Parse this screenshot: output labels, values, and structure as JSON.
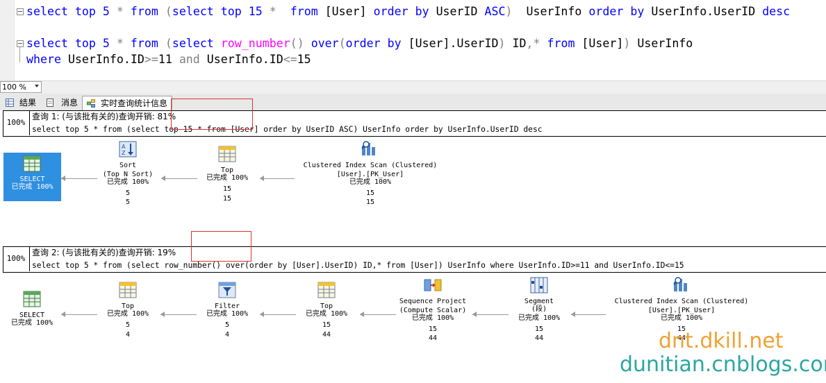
{
  "editor": {
    "line1": {
      "a": "select",
      "b": " top ",
      "c": "5",
      " d": " * ",
      "e": "from",
      "f": " (",
      "g": "select",
      "h": " top ",
      "i": "15 * ",
      "j": " from",
      "k": " [User] ",
      "l": "order by",
      "m": " UserID ",
      "n": "ASC",
      "o": ")  UserInfo ",
      "p": "order by",
      "q": " UserInfo.UserID ",
      "r": "desc"
    },
    "line1_parts": [
      "select",
      " top 5 ",
      "*",
      " ",
      "from",
      " ",
      "(",
      "select",
      " top 15 ",
      "*",
      "  ",
      "from",
      " [User] ",
      "order by",
      " UserID ",
      "ASC",
      ")",
      "  UserInfo ",
      "order by",
      " UserInfo.UserID ",
      "desc"
    ],
    "line2_parts": [
      "select",
      " top 5 ",
      "*",
      " ",
      "from",
      " ",
      "(",
      "select",
      " ",
      "row_number",
      "()",
      " ",
      "over",
      "(",
      "order by",
      " [User].UserID",
      ")",
      " ID",
      ",",
      "*",
      " ",
      "from",
      " [User]",
      ")",
      " UserInfo"
    ],
    "line3_parts": [
      "where",
      " UserInfo.ID",
      ">=",
      "11",
      " ",
      "and",
      " UserInfo.ID",
      "<=",
      "15"
    ]
  },
  "zoom": {
    "value": "100 %"
  },
  "tabs": [
    {
      "label": "结果",
      "icon": "grid-icon"
    },
    {
      "label": "消息",
      "icon": "message-icon"
    },
    {
      "label": "实时查询统计信息",
      "icon": "live-stats-icon",
      "active": true
    }
  ],
  "query1": {
    "pct": "100%",
    "title": "查询 1: (与该批有关的)查询开销: 81%",
    "sql": "select top 5 * from (select top 15 * from [User] order by UserID ASC) UserInfo order by UserInfo.UserID desc",
    "nodes": [
      {
        "name": "SELECT",
        "status": "已完成 100%"
      },
      {
        "name": "Sort",
        "sub": "(Top N Sort)",
        "status": "已完成 100%",
        "a": "5",
        "b": "5"
      },
      {
        "name": "Top",
        "status": "已完成 100%",
        "a": "15",
        "b": "15"
      },
      {
        "name": "Clustered Index Scan (Clustered)",
        "sub": "[User].[PK_User]",
        "status": "已完成 100%",
        "a": "15",
        "b": "15"
      }
    ]
  },
  "query2": {
    "pct": "100%",
    "title": "查询 2: (与该批有关的)查询开销: 19%",
    "sql": "select top 5 * from (select row_number() over(order by [User].UserID) ID,* from [User]) UserInfo where UserInfo.ID>=11 and UserInfo.ID<=15",
    "nodes": [
      {
        "name": "SELECT",
        "status": "已完成 100%"
      },
      {
        "name": "Top",
        "status": "已完成 100%",
        "a": "5",
        "b": "4"
      },
      {
        "name": "Filter",
        "status": "已完成 100%",
        "a": "5",
        "b": "4"
      },
      {
        "name": "Top",
        "status": "已完成 100%",
        "a": "15",
        "b": "44"
      },
      {
        "name": "Sequence Project",
        "sub": "(Compute Scalar)",
        "status": "已完成 100%",
        "a": "15",
        "b": "44"
      },
      {
        "name": "Segment",
        "sub": "(段)",
        "status": "已完成 100%",
        "a": "15",
        "b": "44"
      },
      {
        "name": "Clustered Index Scan (Clustered)",
        "sub": "[User].[PK_User]",
        "status": "已完成 100%",
        "a": "15",
        "b": "44"
      }
    ]
  },
  "watermark": {
    "line1": "dnt.dkill.net",
    "line2": "dunitian.cnblogs.com"
  },
  "colors": {
    "keyword": "#0000ff",
    "function": "#ff00ff",
    "operator": "#808080",
    "selected": "#2f8fe0",
    "highlight": "#e03030"
  }
}
